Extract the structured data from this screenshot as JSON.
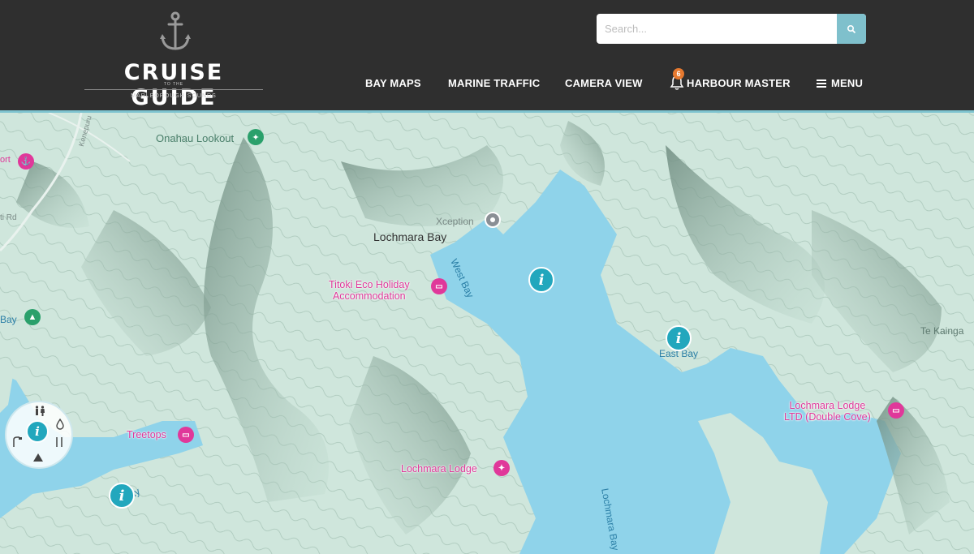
{
  "header": {
    "logo": {
      "title": "CRUISE GUIDE",
      "small_line": "TO THE",
      "subtitle": "MARLBOROUGH SOUNDS"
    },
    "search": {
      "placeholder": "Search..."
    },
    "nav": [
      {
        "label": "BAY MAPS"
      },
      {
        "label": "MARINE TRAFFIC"
      },
      {
        "label": "CAMERA VIEW"
      },
      {
        "label": "HARBOUR MASTER",
        "badge": "6"
      },
      {
        "label": "MENU"
      }
    ]
  },
  "map": {
    "places": {
      "lochmara_bay": "Lochmara Bay",
      "onahau_lookout": "Onahau Lookout",
      "xception": "Xception",
      "west_bay": "West Bay",
      "east_bay": "East Bay",
      "te_kainga": "Te Kainga",
      "lochmara_bay_water": "Lochmara Bay",
      "bay_left": "Bay",
      "bay_bottom": "Bay",
      "kenepuru": "Kenepuru",
      "port_partial": "ort",
      "road_partial": "ti Rd"
    },
    "accommodation": {
      "titoki": "Titoki Eco Holiday\nAccommodation",
      "treetops": "Treetops",
      "lochmara_lodge": "Lochmara Lodge",
      "lochmara_lodge_ltd": "Lochmara Lodge\nLTD (Double Cove)"
    },
    "colors": {
      "water": "#8fd3ea",
      "land": "#cfe6dc",
      "land_shadow": "#7f9c90",
      "accent": "#22a7bd",
      "pink": "#e0389a"
    }
  }
}
